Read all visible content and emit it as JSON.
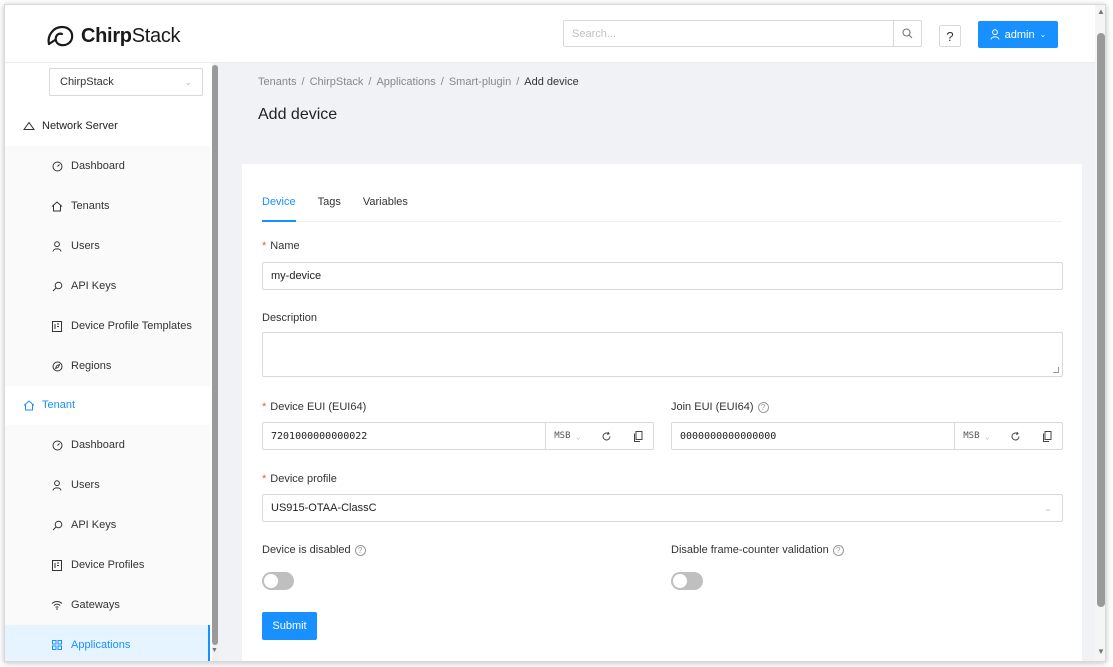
{
  "header": {
    "logo": {
      "text_bold": "Chirp",
      "text_regular": "Stack"
    },
    "search": {
      "placeholder": "Search..."
    },
    "help_label": "?",
    "user_label": "admin"
  },
  "sidebar": {
    "tenant_select": "ChirpStack",
    "network_server": {
      "label": "Network Server",
      "items": [
        {
          "label": "Dashboard",
          "icon": "dashboard-icon"
        },
        {
          "label": "Tenants",
          "icon": "home-icon"
        },
        {
          "label": "Users",
          "icon": "user-icon"
        },
        {
          "label": "API Keys",
          "icon": "key-icon"
        },
        {
          "label": "Device Profile Templates",
          "icon": "template-icon"
        },
        {
          "label": "Regions",
          "icon": "compass-icon"
        }
      ]
    },
    "tenant": {
      "label": "Tenant",
      "items": [
        {
          "label": "Dashboard",
          "icon": "dashboard-icon"
        },
        {
          "label": "Users",
          "icon": "user-icon"
        },
        {
          "label": "API Keys",
          "icon": "key-icon"
        },
        {
          "label": "Device Profiles",
          "icon": "template-icon"
        },
        {
          "label": "Gateways",
          "icon": "wifi-icon"
        },
        {
          "label": "Applications",
          "icon": "apps-icon",
          "active": true
        }
      ]
    }
  },
  "breadcrumb": [
    "Tenants",
    "ChirpStack",
    "Applications",
    "Smart-plugin",
    "Add device"
  ],
  "page_title": "Add device",
  "tabs": [
    "Device",
    "Tags",
    "Variables"
  ],
  "form": {
    "name_label": "Name",
    "name_value": "my-device",
    "description_label": "Description",
    "description_value": "",
    "dev_eui_label": "Device EUI (EUI64)",
    "dev_eui_value": "7201000000000022",
    "dev_eui_byte_order": "MSB",
    "join_eui_label": "Join EUI (EUI64)",
    "join_eui_value": "0000000000000000",
    "join_eui_byte_order": "MSB",
    "device_profile_label": "Device profile",
    "device_profile_value": "US915-OTAA-ClassC",
    "disabled_label": "Device is disabled",
    "disabled_value": false,
    "fcnt_label": "Disable frame-counter validation",
    "fcnt_value": false,
    "submit_label": "Submit"
  },
  "colors": {
    "accent": "#1890ff",
    "required": "#ff4d4f"
  }
}
